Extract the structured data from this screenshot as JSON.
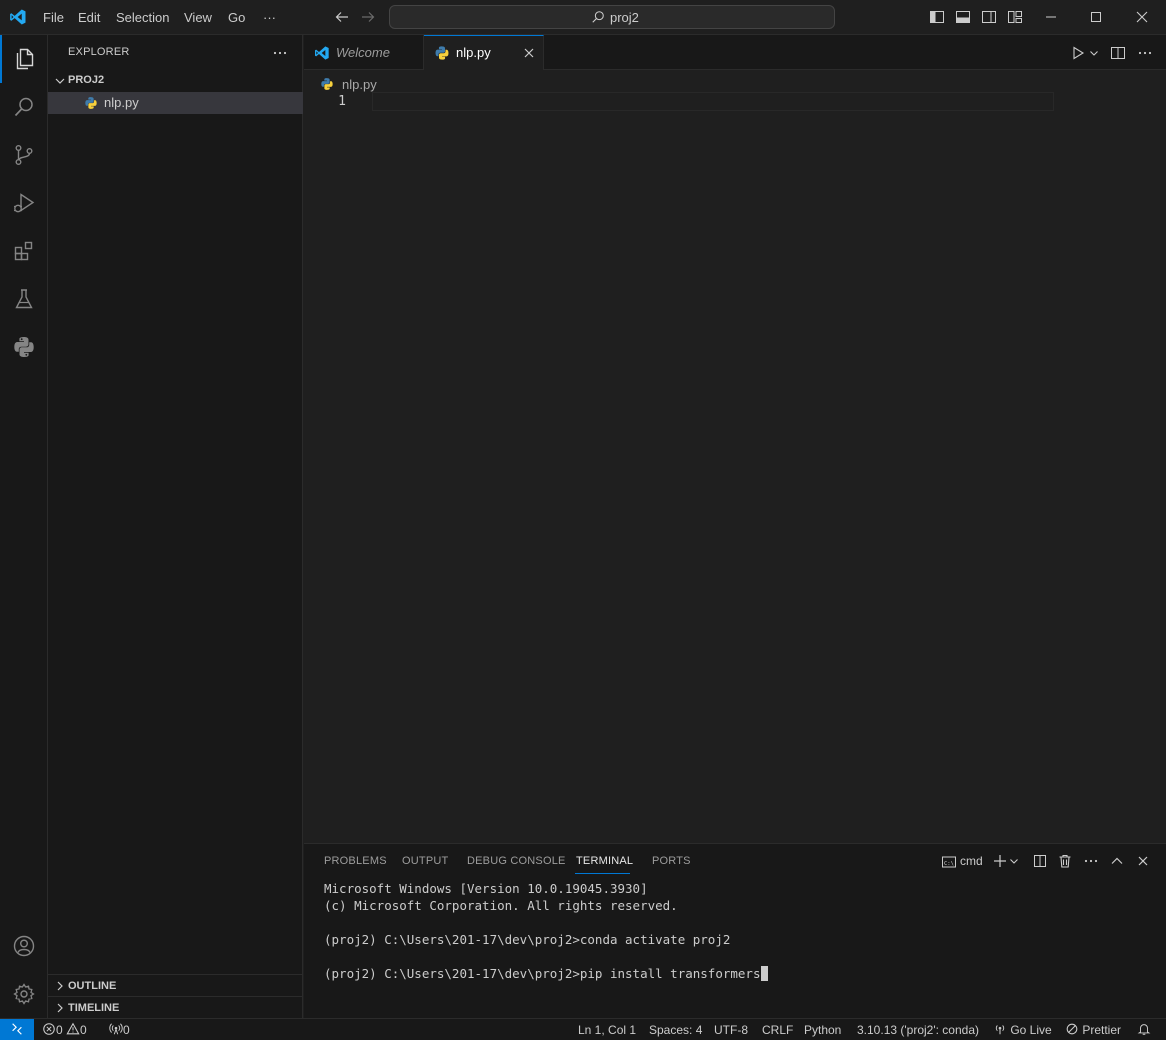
{
  "titlebar": {
    "menu": [
      "File",
      "Edit",
      "Selection",
      "View",
      "Go",
      "···"
    ],
    "search": "proj2"
  },
  "sidebar": {
    "title": "EXPLORER",
    "folder": "PROJ2",
    "files": [
      {
        "name": "nlp.py",
        "icon": "python-file-icon"
      }
    ],
    "sections": [
      "OUTLINE",
      "TIMELINE"
    ]
  },
  "tabs": [
    {
      "label": "Welcome",
      "italic": true,
      "active": false
    },
    {
      "label": "nlp.py",
      "italic": false,
      "active": true
    }
  ],
  "editor": {
    "breadcrumb": "nlp.py",
    "lines": [
      "1"
    ]
  },
  "panel": {
    "tabs": [
      "PROBLEMS",
      "OUTPUT",
      "DEBUG CONSOLE",
      "TERMINAL",
      "PORTS"
    ],
    "active_tab": "TERMINAL",
    "terminal_name": "cmd",
    "terminal_lines": [
      "Microsoft Windows [Version 10.0.19045.3930]",
      "(c) Microsoft Corporation. All rights reserved.",
      "",
      "(proj2) C:\\Users\\201-17\\dev\\proj2>conda activate proj2",
      "",
      "(proj2) C:\\Users\\201-17\\dev\\proj2>pip install transformers"
    ]
  },
  "statusbar": {
    "errors": "0",
    "warnings": "0",
    "ports": "0",
    "position": "Ln 1, Col 1",
    "spaces": "Spaces: 4",
    "encoding": "UTF-8",
    "eol": "CRLF",
    "language": "Python",
    "interpreter": "3.10.13 ('proj2': conda)",
    "golive": "Go Live",
    "prettier": "Prettier"
  },
  "colors": {
    "accent": "#0078d4",
    "background": "#1f1f1f",
    "sidebar": "#181818",
    "vscode_blue": "#23a9f2",
    "python_blue": "#3f7cac",
    "python_yellow": "#f7d13d"
  }
}
